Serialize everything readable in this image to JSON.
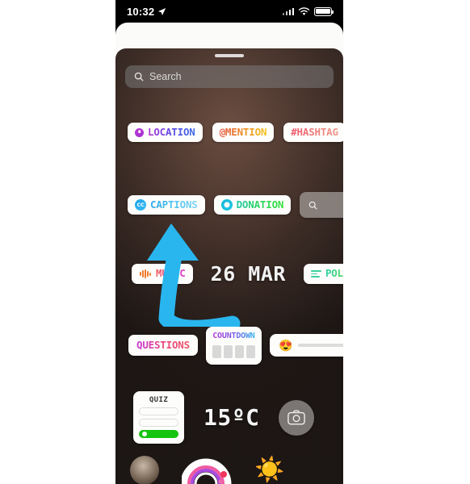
{
  "statusbar": {
    "time": "10:32",
    "location_icon": "location-arrow-icon",
    "signal_icon": "cellular-signal-icon",
    "wifi_icon": "wifi-icon",
    "battery_icon": "battery-icon"
  },
  "tray": {
    "grabber": "drag-handle",
    "search": {
      "icon": "search-icon",
      "placeholder": "Search"
    }
  },
  "stickers": {
    "location": {
      "label": "LOCATION",
      "icon": "location-pin-icon"
    },
    "mention": {
      "label": "@MENTION"
    },
    "hashtag": {
      "label": "#HASHTAG"
    },
    "captions": {
      "label": "CAPTIONS",
      "badge": "CC"
    },
    "donation": {
      "label": "DONATION",
      "icon": "heart-circle-icon"
    },
    "gif_search": {
      "icon": "search-icon"
    },
    "music": {
      "label": "MUSIC",
      "icon": "music-waveform-icon"
    },
    "date": {
      "label": "26 MAR"
    },
    "poll": {
      "label": "POLL",
      "icon": "poll-bars-icon"
    },
    "questions": {
      "label": "QUESTIONS"
    },
    "countdown": {
      "label": "COUNTDOWN",
      "digits": [
        "",
        "",
        "",
        ""
      ]
    },
    "emoji_slider": {
      "emoji": "😍"
    },
    "quiz": {
      "label": "QUIZ",
      "options": [
        "",
        "",
        ""
      ],
      "correct_index": 2
    },
    "temperature": {
      "label": "15ºC"
    },
    "camera": {
      "icon": "camera-icon"
    },
    "avatar": {
      "icon": "avatar-icon"
    },
    "rainbow": {
      "icon": "rainbow-arch-icon"
    },
    "sun": {
      "icon": "sun-icon"
    }
  },
  "annotation": {
    "arrow": "curved-arrow-pointing-to-captions",
    "color": "#29b6ef"
  }
}
